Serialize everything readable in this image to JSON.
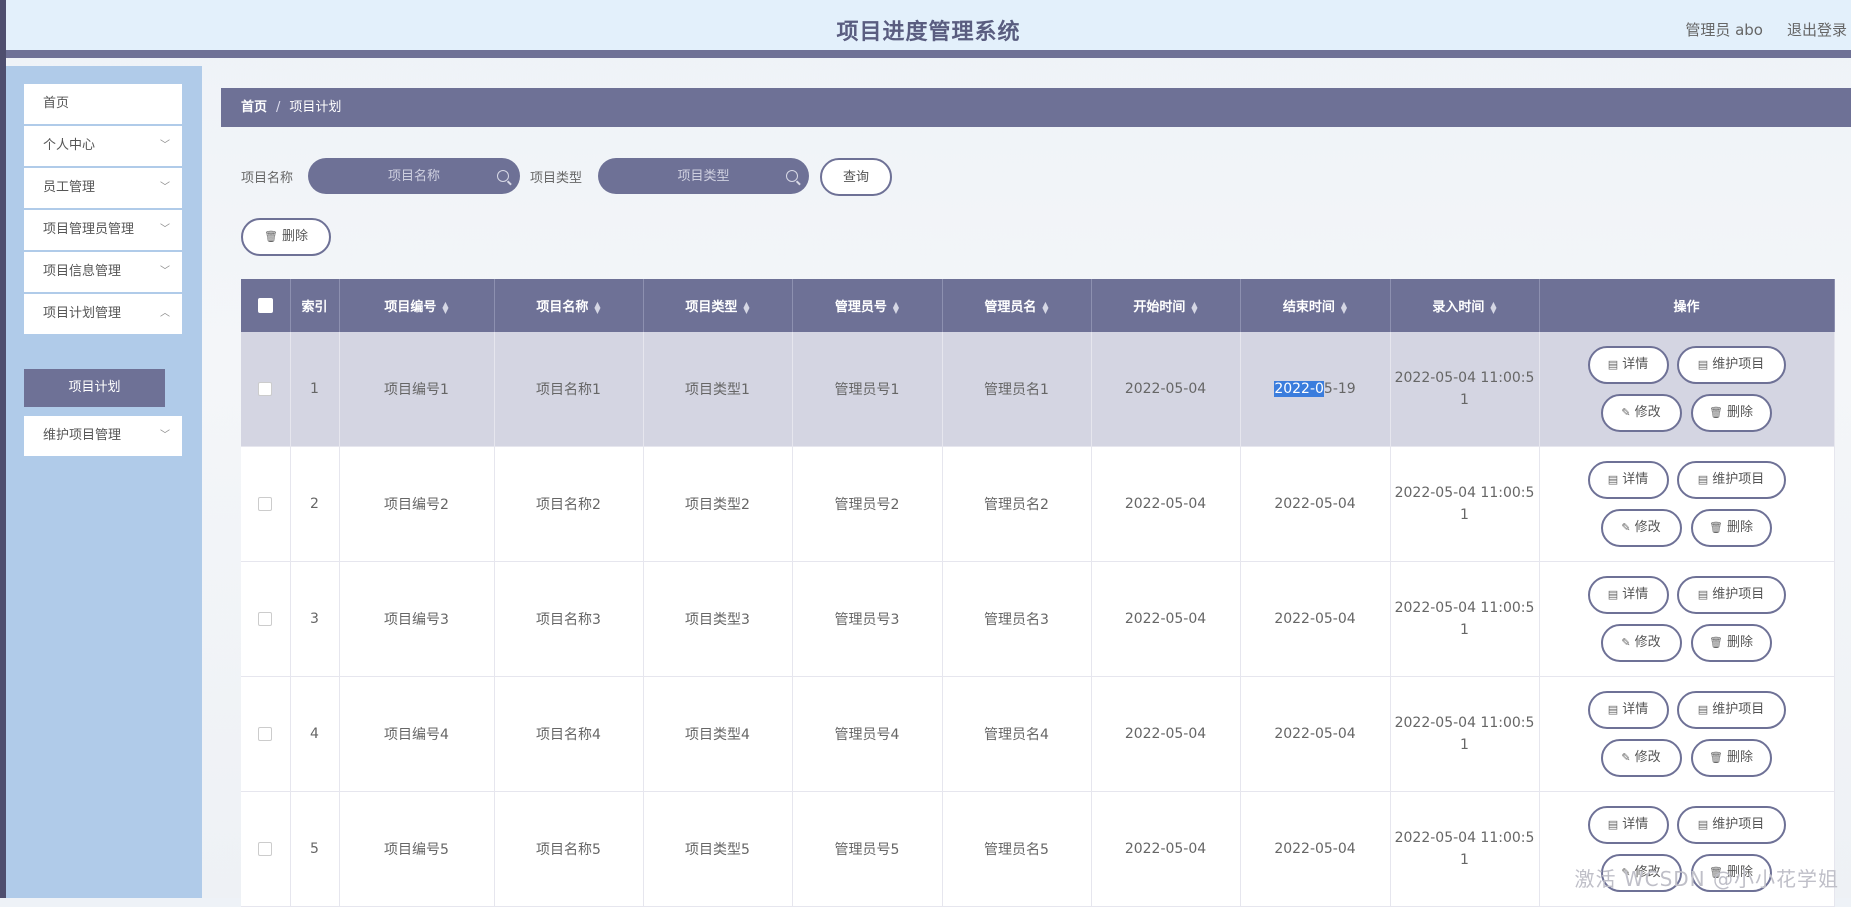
{
  "header": {
    "title": "项目进度管理系统",
    "user": "管理员 abo",
    "logout": "退出登录"
  },
  "sidebar": {
    "items": [
      {
        "label": "首页",
        "has_chevron": false
      },
      {
        "label": "个人中心",
        "has_chevron": true
      },
      {
        "label": "员工管理",
        "has_chevron": true
      },
      {
        "label": "项目管理员管理",
        "has_chevron": true
      },
      {
        "label": "项目信息管理",
        "has_chevron": true
      },
      {
        "label": "项目计划管理",
        "has_chevron": true
      },
      {
        "label": "维护项目管理",
        "has_chevron": true
      }
    ],
    "active_sub": "项目计划"
  },
  "breadcrumb": {
    "home": "首页",
    "separator": "/",
    "current": "项目计划"
  },
  "search": {
    "name_label": "项目名称",
    "name_placeholder": "项目名称",
    "type_label": "项目类型",
    "type_placeholder": "项目类型",
    "query_button": "查询"
  },
  "toolbar": {
    "delete_button": "删除"
  },
  "table": {
    "headers": {
      "index": "索引",
      "project_no": "项目编号",
      "project_name": "项目名称",
      "project_type": "项目类型",
      "manager_no": "管理员号",
      "manager_name": "管理员名",
      "start_time": "开始时间",
      "end_time": "结束时间",
      "entry_time": "录入时间",
      "actions": "操作"
    },
    "actions": {
      "detail": "详情",
      "maintain": "维护项目",
      "edit": "修改",
      "delete": "删除"
    },
    "rows": [
      {
        "index": "1",
        "project_no": "项目编号1",
        "project_name": "项目名称1",
        "project_type": "项目类型1",
        "manager_no": "管理员号1",
        "manager_name": "管理员名1",
        "start_time": "2022-05-04",
        "end_time_selected": "2022-0",
        "end_time_rest": "5-19",
        "entry_time_1": "2022-05-04 11:00:5",
        "entry_time_2": "1"
      },
      {
        "index": "2",
        "project_no": "项目编号2",
        "project_name": "项目名称2",
        "project_type": "项目类型2",
        "manager_no": "管理员号2",
        "manager_name": "管理员名2",
        "start_time": "2022-05-04",
        "end_time": "2022-05-04",
        "entry_time_1": "2022-05-04 11:00:5",
        "entry_time_2": "1"
      },
      {
        "index": "3",
        "project_no": "项目编号3",
        "project_name": "项目名称3",
        "project_type": "项目类型3",
        "manager_no": "管理员号3",
        "manager_name": "管理员名3",
        "start_time": "2022-05-04",
        "end_time": "2022-05-04",
        "entry_time_1": "2022-05-04 11:00:5",
        "entry_time_2": "1"
      },
      {
        "index": "4",
        "project_no": "项目编号4",
        "project_name": "项目名称4",
        "project_type": "项目类型4",
        "manager_no": "管理员号4",
        "manager_name": "管理员名4",
        "start_time": "2022-05-04",
        "end_time": "2022-05-04",
        "entry_time_1": "2022-05-04 11:00:5",
        "entry_time_2": "1"
      },
      {
        "index": "5",
        "project_no": "项目编号5",
        "project_name": "项目名称5",
        "project_type": "项目类型5",
        "manager_no": "管理员号5",
        "manager_name": "管理员名5",
        "start_time": "2022-05-04",
        "end_time": "2022-05-04",
        "entry_time_1": "2022-05-04 11:00:5",
        "entry_time_2": "1"
      }
    ]
  },
  "watermark": "激活 WCSDN @小小花学姐",
  "colors": {
    "primary": "#6e7196",
    "sidebar": "#b0cbe9",
    "header": "#e3f0fb",
    "selection": "#3b7ddd"
  }
}
